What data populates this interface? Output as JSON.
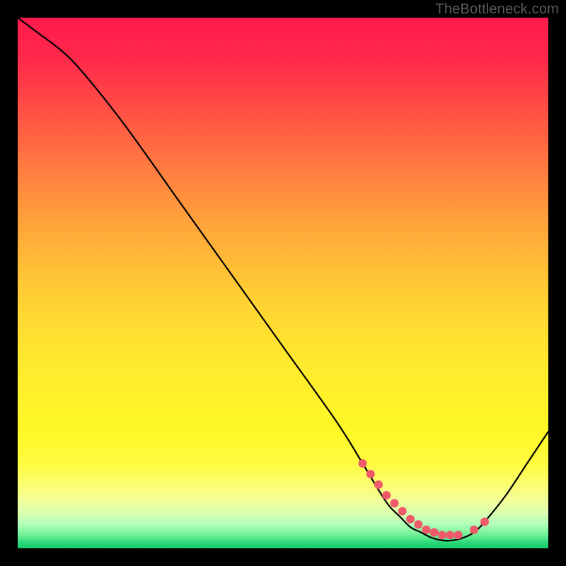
{
  "watermark": "TheBottleneck.com",
  "chart_data": {
    "type": "line",
    "title": "",
    "xlabel": "",
    "ylabel": "",
    "xlim": [
      0,
      100
    ],
    "ylim": [
      0,
      100
    ],
    "grid": false,
    "legend": false,
    "series": [
      {
        "name": "bottleneck-curve",
        "x": [
          0,
          4,
          8,
          12,
          20,
          30,
          40,
          50,
          60,
          65,
          68,
          70,
          72,
          74,
          76,
          78,
          80,
          82,
          84,
          86,
          88,
          92,
          96,
          100
        ],
        "y": [
          100,
          97,
          94,
          90,
          80,
          66,
          52,
          38,
          24,
          16,
          11,
          8,
          6,
          4,
          3,
          2,
          1.5,
          1.5,
          2,
          3,
          5,
          10,
          16,
          22
        ]
      }
    ],
    "markers": {
      "name": "sweet-spot-dots",
      "x": [
        65,
        66.5,
        68,
        69.5,
        71,
        72.5,
        74,
        75.5,
        77,
        78.5,
        80,
        81.5,
        83,
        86,
        88
      ],
      "y": [
        16,
        14,
        12,
        10,
        8.5,
        7,
        5.5,
        4.5,
        3.5,
        3,
        2.5,
        2.5,
        2.5,
        3.5,
        5
      ]
    },
    "background_gradient": {
      "top": "#ff1a4d",
      "mid": "#fff22a",
      "bottom": "#14c86c"
    }
  }
}
